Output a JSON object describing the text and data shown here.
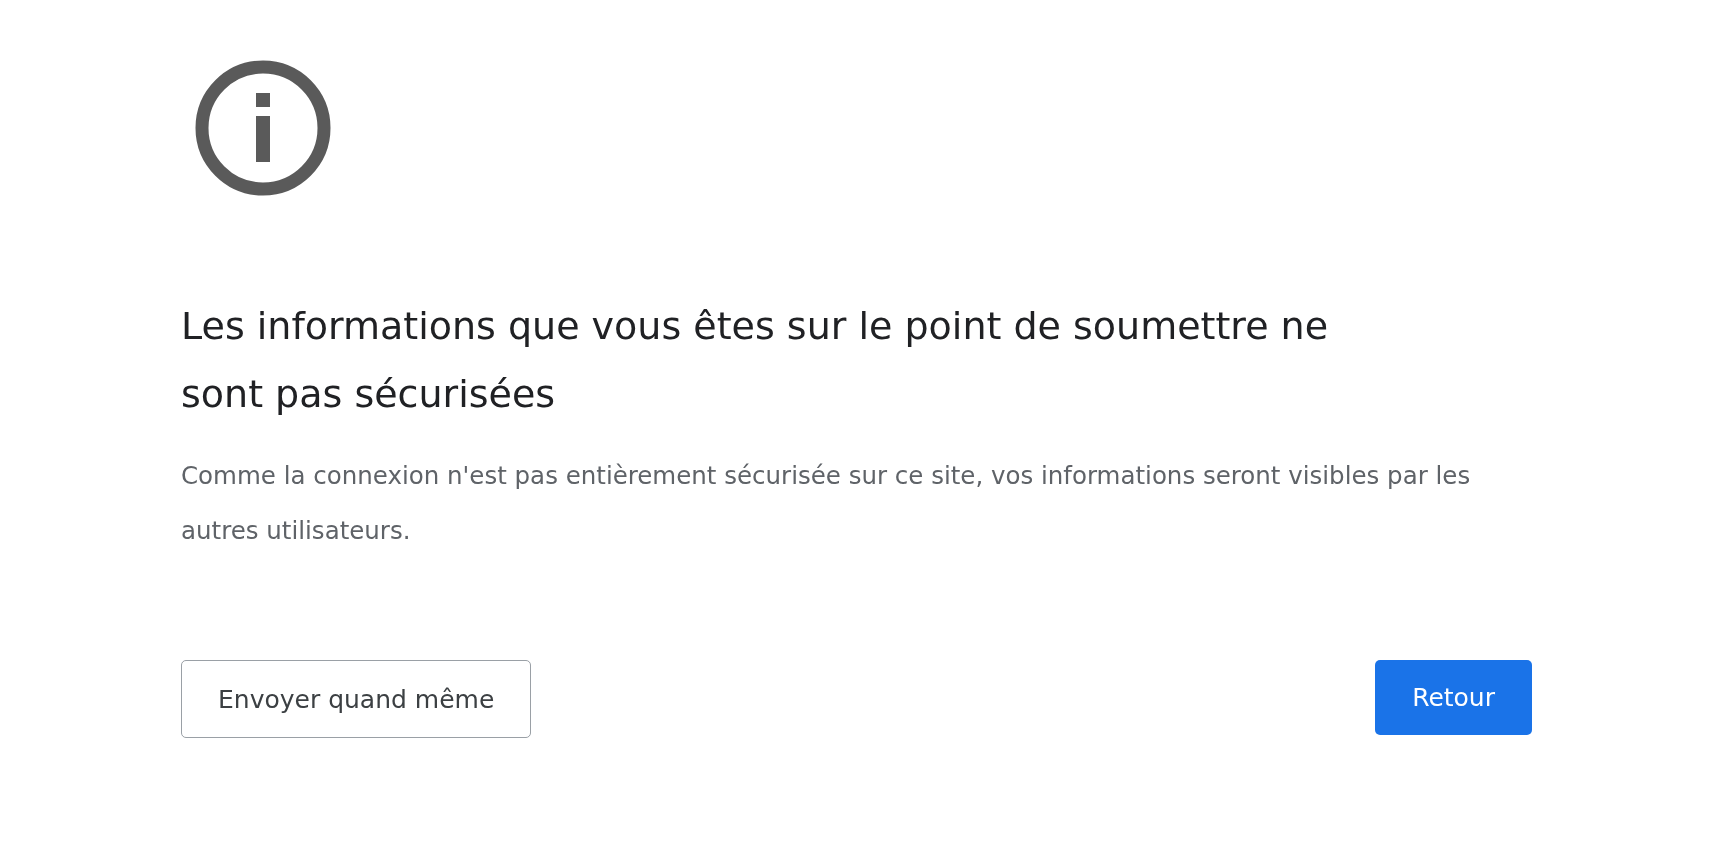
{
  "heading": "Les informations que vous êtes sur le point de soumettre ne sont pas sécurisées",
  "message": "Comme la connexion n'est pas entièrement sécurisée sur ce site, vos informations seront visibles par les autres utilisateurs.",
  "buttons": [
    {
      "label": "Envoyer quand même",
      "kind": "secondary"
    },
    {
      "label": "Retour",
      "kind": "primary"
    }
  ]
}
